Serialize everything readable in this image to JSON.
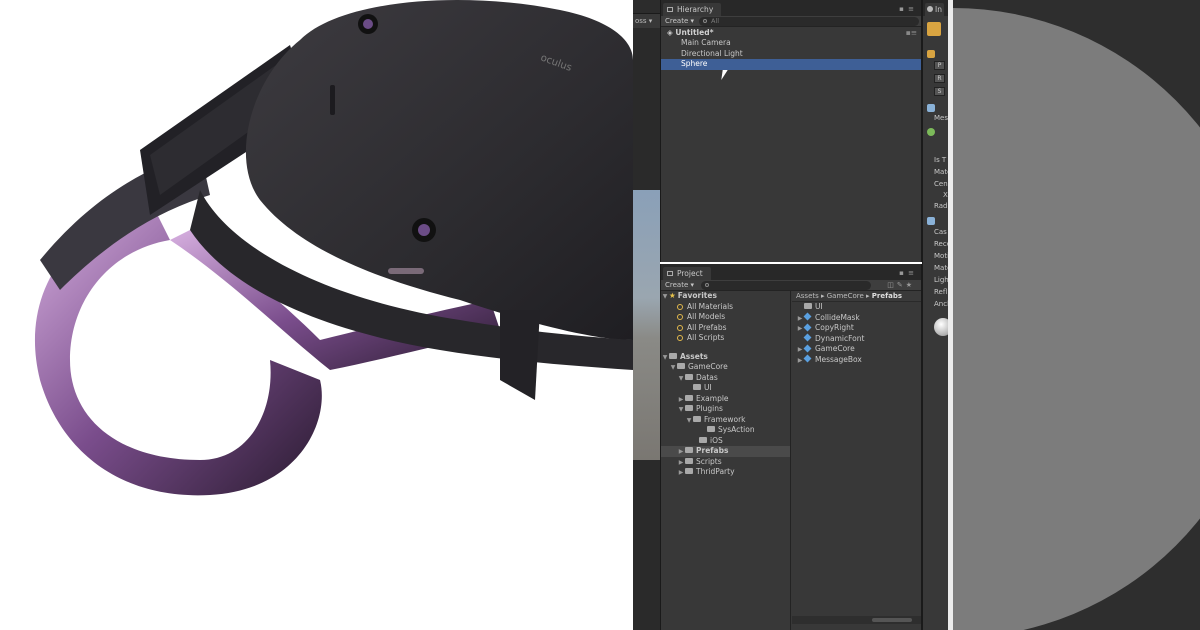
{
  "photo": {
    "logo_text": "oculus"
  },
  "scene": {
    "toolbar_text": "oss ▾"
  },
  "hierarchy": {
    "tab_label": "Hierarchy",
    "create_label": "Create ▾",
    "search_placeholder": "All",
    "scene_name": "Untitled*",
    "items": [
      "Main Camera",
      "Directional Light",
      "Sphere"
    ],
    "selected": "Sphere"
  },
  "project": {
    "tab_label": "Project",
    "create_label": "Create ▾",
    "favorites_label": "Favorites",
    "favorites": [
      "All Materials",
      "All Models",
      "All Prefabs",
      "All Scripts"
    ],
    "assets_label": "Assets",
    "tree": {
      "gamecore": "GameCore",
      "datas": "Datas",
      "ui": "UI",
      "example": "Example",
      "plugins": "Plugins",
      "framework": "Framework",
      "sysaction": "SysAction",
      "ios": "iOS",
      "prefabs": "Prefabs",
      "scripts": "Scripts",
      "thirdparty": "ThridParty"
    },
    "breadcrumb": {
      "part1": "Assets",
      "part2": "GameCore",
      "part3": "Prefabs"
    },
    "files": [
      "UI",
      "CollideMask",
      "CopyRight",
      "DynamicFont",
      "GameCore",
      "MessageBox"
    ]
  },
  "inspector": {
    "tab_label": "In",
    "rows": [
      "Mes",
      "Is T",
      "Mate",
      "Cen",
      "X",
      "Rad",
      "Cas",
      "Rece",
      "Moti",
      "Mate",
      "Ligh",
      "Refl",
      "Anch"
    ],
    "boxes": [
      "P",
      "R",
      "S"
    ]
  },
  "colors": {
    "selection": "#3e5f96",
    "panel": "#383838",
    "headset_purple": "#b07ac8"
  }
}
